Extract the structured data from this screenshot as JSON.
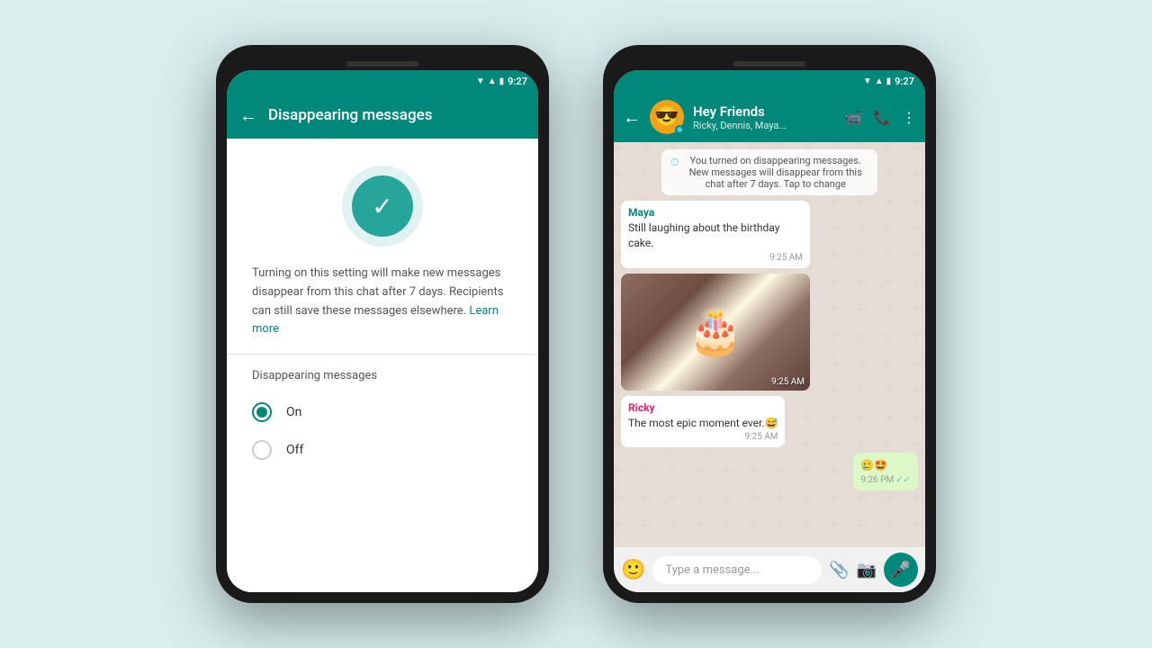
{
  "background_color": "#d8eeec",
  "phone1": {
    "status_bar": {
      "time": "9:27"
    },
    "header": {
      "title": "Disappearing messages",
      "back_label": "←"
    },
    "icon": {
      "symbol": "✓",
      "aria": "timer-checkmark"
    },
    "description": "Turning on this setting will make new messages disappear from this chat after 7 days. Recipients can still save these messages elsewhere.",
    "learn_more": "Learn more",
    "section_label": "Disappearing messages",
    "options": [
      {
        "label": "On",
        "selected": true,
        "value": "on"
      },
      {
        "label": "Off",
        "selected": false,
        "value": "off"
      }
    ]
  },
  "phone2": {
    "status_bar": {
      "time": "9:27"
    },
    "header": {
      "back_label": "←",
      "group_name": "Hey Friends",
      "members": "Ricky, Dennis, Maya...",
      "avatar_emoji": "😎"
    },
    "system_message": "You turned on disappearing messages. New messages will disappear from this chat after 7 days. Tap to change",
    "messages": [
      {
        "type": "received",
        "sender": "Maya",
        "sender_color": "maya",
        "text": "Still laughing about the birthday cake.",
        "time": "9:25 AM"
      },
      {
        "type": "image",
        "image_emoji": "🎂",
        "time": "9:25 AM"
      },
      {
        "type": "received",
        "sender": "Ricky",
        "sender_color": "ricky",
        "text": "The most epic moment ever.😅",
        "time": "9:25 AM"
      },
      {
        "type": "sent",
        "text": "🥲🤩",
        "time": "9:26 PM",
        "read": true
      }
    ],
    "input_placeholder": "Type a message..."
  }
}
